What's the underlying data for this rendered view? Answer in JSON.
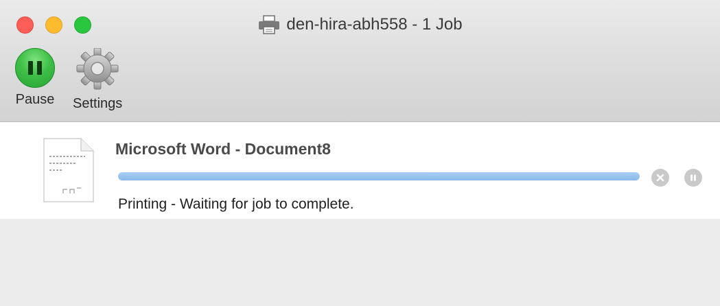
{
  "window": {
    "title": "den-hira-abh558 - 1 Job",
    "title_icon": "printer-icon"
  },
  "toolbar": {
    "pause_label": "Pause",
    "settings_label": "Settings",
    "pause_icon": "pause-icon",
    "settings_icon": "gear-icon"
  },
  "jobs": [
    {
      "name": "Microsoft Word - Document8",
      "status": "Printing - Waiting for job to complete.",
      "progress": 1.0,
      "thumbnail_icon": "document-thumbnail",
      "actions": [
        "cancel-icon",
        "hold-icon"
      ]
    }
  ],
  "colors": {
    "close": "#fc5d57",
    "minimize": "#fdbc2e",
    "maximize": "#29c73f",
    "progress": "#8ab9ea",
    "pause_green": "#3fbf48"
  }
}
